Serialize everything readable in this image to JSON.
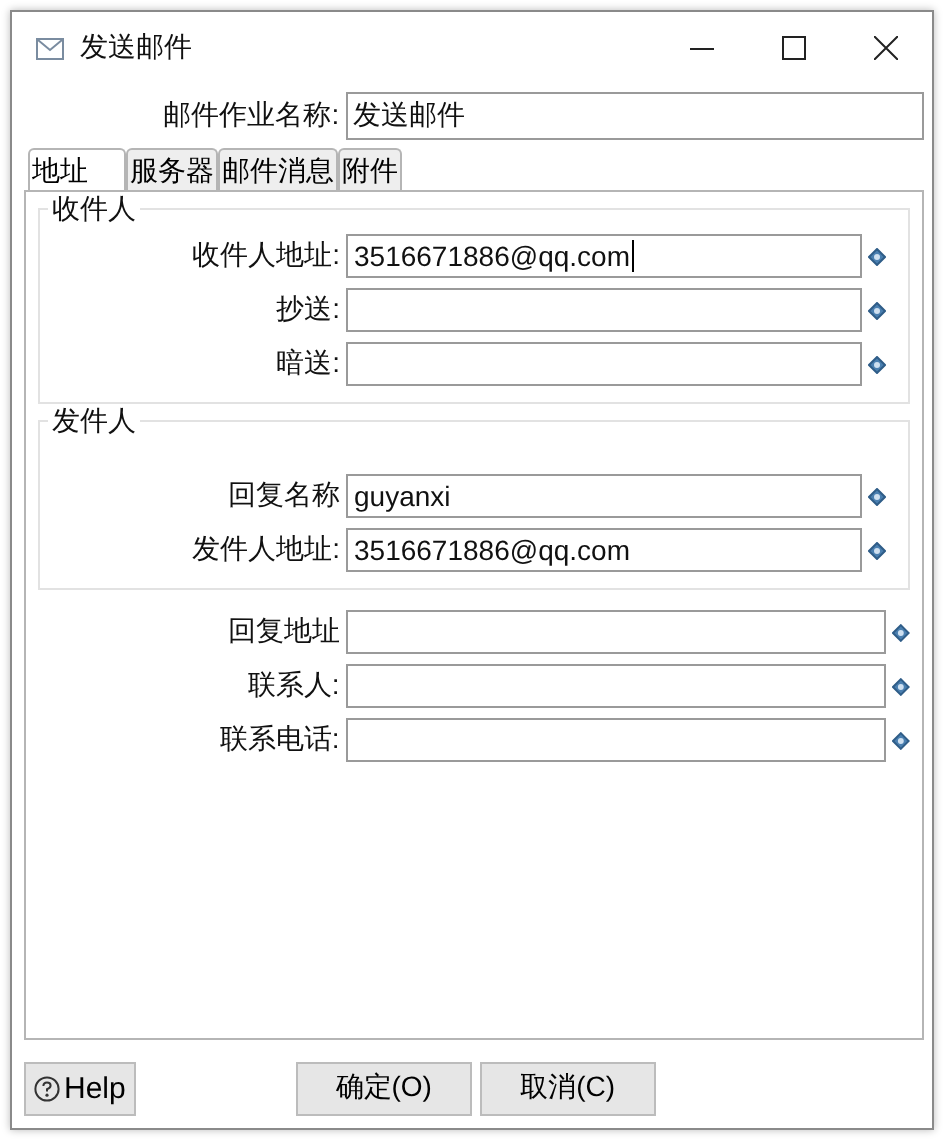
{
  "window": {
    "title": "发送邮件"
  },
  "job_name": {
    "label": "邮件作业名称:",
    "value": "发送邮件"
  },
  "tabs": [
    {
      "label": "地址",
      "selected": true
    },
    {
      "label": "服务器",
      "selected": false
    },
    {
      "label": "邮件消息",
      "selected": false
    },
    {
      "label": "附件",
      "selected": false
    }
  ],
  "groups": [
    {
      "title": "收件人",
      "fields": [
        {
          "label": "收件人地址:",
          "value": "3516671886@qq.com",
          "focused": true
        },
        {
          "label": "抄送:",
          "focused": false
        },
        {
          "label": "暗送:",
          "focused": false
        }
      ]
    },
    {
      "title": "发件人",
      "fields": [
        {
          "label": "回复名称",
          "value": "guyanxi",
          "focused": false
        },
        {
          "label": "发件人地址:",
          "value": "3516671886@qq.com",
          "focused": false
        }
      ]
    }
  ],
  "fields": [
    {
      "label": "回复地址",
      "focused": false
    },
    {
      "label": "联系人:",
      "focused": false
    },
    {
      "label": "联系电话:",
      "focused": false
    }
  ],
  "help_button": "Help",
  "buttons": [
    "确定(O)",
    "取消(C)"
  ]
}
